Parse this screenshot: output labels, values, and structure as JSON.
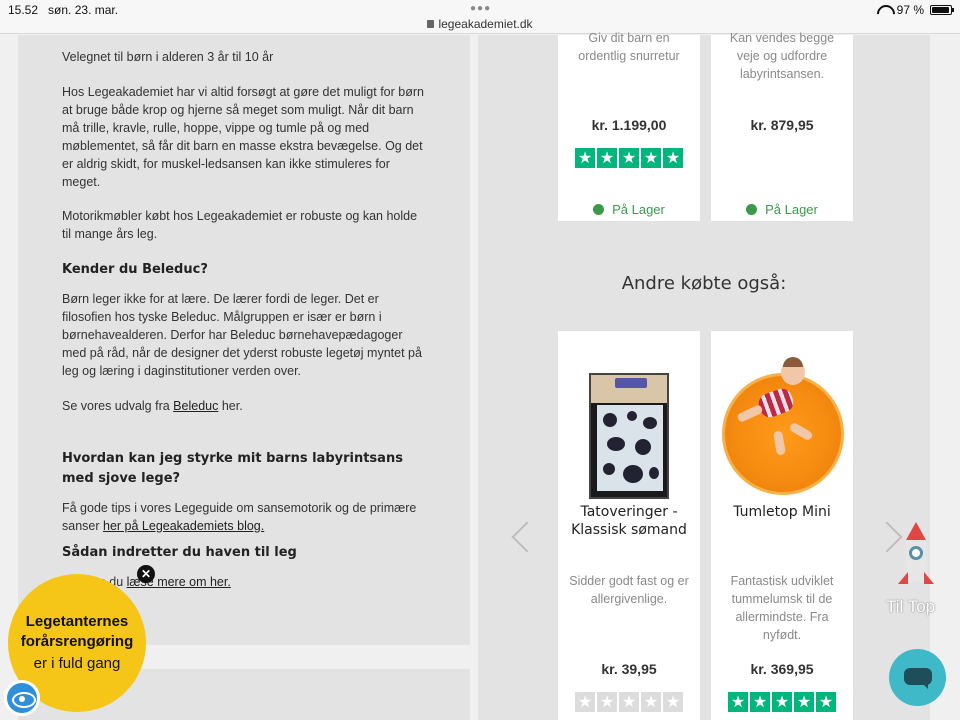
{
  "status_bar": {
    "time": "15.52",
    "date": "søn. 23. mar.",
    "url": "legeakademiet.dk",
    "battery": "97 %",
    "battery_level": 0.97
  },
  "article": {
    "p_age": "Velegnet til børn i alderen 3 år til 10 år",
    "p_intro": "Hos Legeakademiet har vi altid forsøgt at gøre det muligt for børn at bruge både krop og hjerne så meget som muligt. Når dit barn må trille, kravle, rulle, hoppe, vippe og tumle på og med møblementet, så får dit barn en masse ekstra bevægelse. Og det er aldrig skidt, for muskel-ledsansen kan ikke stimuleres for meget.",
    "p_robust": "Motorikmøbler købt hos Legeakademiet er robuste og kan holde til mange års leg.",
    "h_beleduc": "Kender du Beleduc?",
    "p_beleduc": "Børn leger ikke for at lære. De lærer fordi de leger. Det er filosofien hos tyske Beleduc. Målgruppen er især er børn i børnehavealderen. Derfor har Beleduc børnehavepædagoger med på råd, når de designer det yderst robuste legetøj myntet på leg og læring i daginstitutioner verden over.",
    "p_udvalg_pre": "Se vores udvalg fra ",
    "p_udvalg_link": "Beleduc",
    "p_udvalg_post": " her.",
    "h_labyrint": "Hvordan kan jeg styrke mit barns labyrintsans med sjove lege?",
    "p_tips_pre": "Få gode tips i vores Legeguide om sansemotorik og de primære sanser ",
    "p_tips_link": "her på Legeakademiets blog.",
    "h_haven": "Sådan indretter du haven til leg",
    "p_haven_pre": "Her kan du ",
    "p_haven_link": "læse mere om her."
  },
  "top_products": [
    {
      "desc": "Giv dit barn en ordentlig snurretur",
      "price": "kr. 1.199,00",
      "rating": 5,
      "stock": "På Lager"
    },
    {
      "desc": "Kan vendes begge veje og udfordre labyrintsansen.",
      "price": "kr. 879,95",
      "stock": "På Lager"
    }
  ],
  "section_title": "Andre købte også:",
  "bottom_products": [
    {
      "name": "Tatoveringer - Klassisk sømand",
      "desc": "Sidder godt fast og er allergivenlige.",
      "price": "kr. 39,95",
      "rating": 0
    },
    {
      "name": "Tumletop Mini",
      "desc": "Fantastisk udviklet tummelumsk til de allermindste. Fra nyfødt.",
      "price": "kr. 369,95",
      "rating": 5
    }
  ],
  "til_top": "Til Top",
  "promo": {
    "line1": "Legetanternes",
    "line2": "forårsrengøring",
    "line3": "er i fuld gang"
  },
  "colors": {
    "trustpilot_green": "#00b67a",
    "stock_green": "#3a9a4a",
    "promo_yellow": "#f5c518",
    "chat_teal": "#3fb8c8"
  }
}
